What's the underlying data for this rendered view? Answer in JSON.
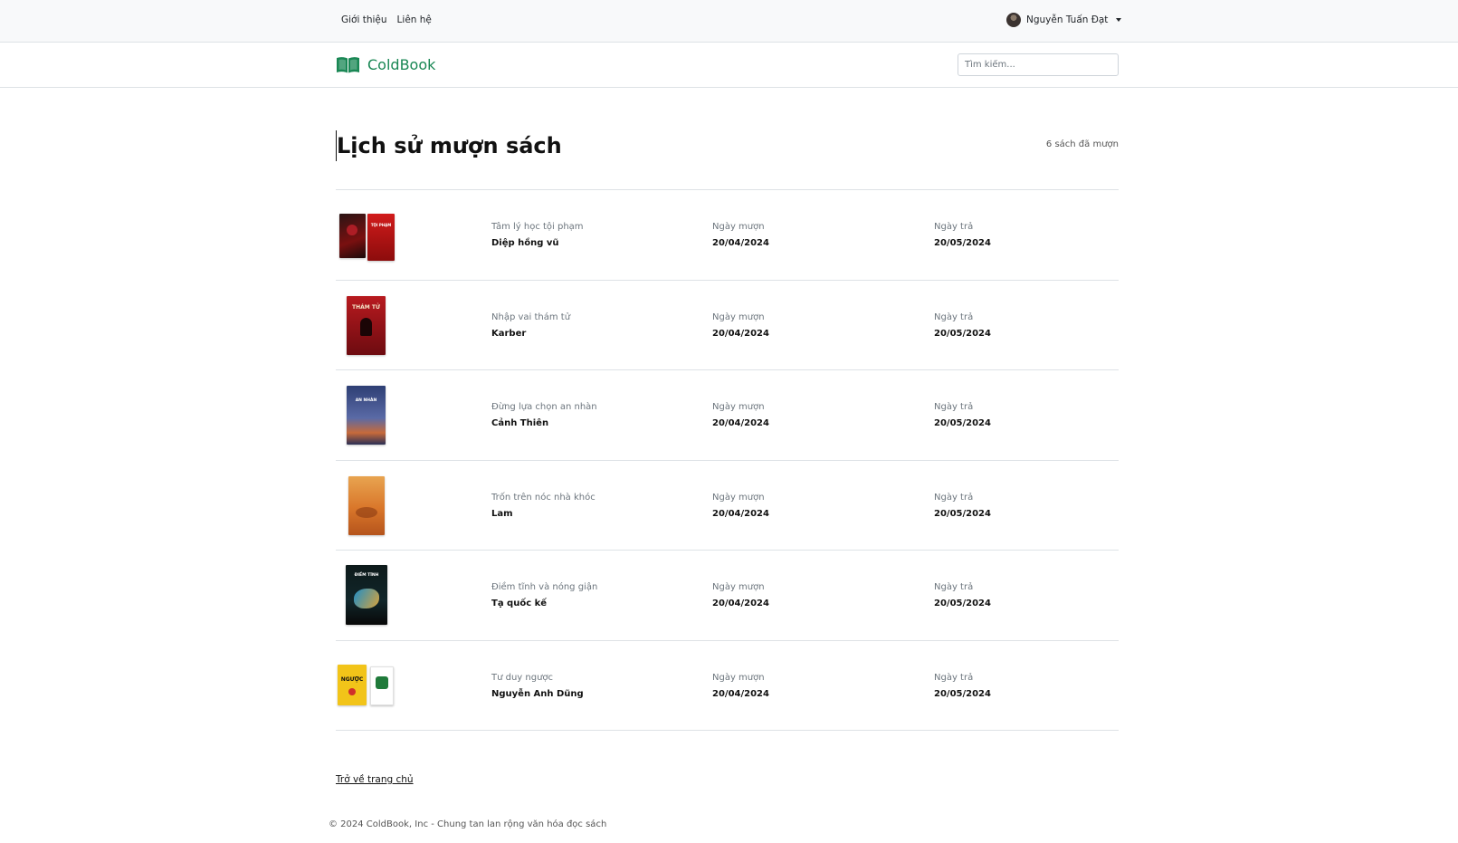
{
  "topnav": {
    "links": [
      "Giới thiệu",
      "Liên hệ"
    ],
    "user_name": "Nguyễn Tuấn Đạt"
  },
  "header": {
    "brand": "ColdBook",
    "search_placeholder": "Tìm kiếm..."
  },
  "page": {
    "title": "Lịch sử mượn sách",
    "count": "6 sách đã mượn"
  },
  "labels": {
    "borrow": "Ngày mượn",
    "return": "Ngày trả"
  },
  "books": [
    {
      "title": "Tâm lý học tội phạm",
      "author": "Diệp hồng vũ",
      "borrow_date": "20/04/2024",
      "return_date": "20/05/2024",
      "cover_text": "TỘI PHẠM"
    },
    {
      "title": "Nhập vai thám tử",
      "author": "Karber",
      "borrow_date": "20/04/2024",
      "return_date": "20/05/2024",
      "cover_text": "THÁM TỬ"
    },
    {
      "title": "Đừng lựa chọn an nhàn",
      "author": "Cảnh Thiên",
      "borrow_date": "20/04/2024",
      "return_date": "20/05/2024",
      "cover_text": "AN NHÀN"
    },
    {
      "title": "Trốn trên nóc nhà khóc",
      "author": "Lam",
      "borrow_date": "20/04/2024",
      "return_date": "20/05/2024",
      "cover_text": ""
    },
    {
      "title": "Điềm tĩnh và nóng giận",
      "author": "Tạ quốc kế",
      "borrow_date": "20/04/2024",
      "return_date": "20/05/2024",
      "cover_text": "ĐIỀM TĨNH"
    },
    {
      "title": "Tư duy ngược",
      "author": "Nguyễn Anh Dũng",
      "borrow_date": "20/04/2024",
      "return_date": "20/05/2024",
      "cover_text": "NGƯỢC"
    }
  ],
  "home_link": "Trở về trang chủ",
  "footer": "© 2024 ColdBook, Inc - Chung tan lan rộng văn hóa đọc sách",
  "colors": {
    "brand": "#198754",
    "topbar_bg": "#f8f9fa",
    "border": "#dee2e6"
  }
}
